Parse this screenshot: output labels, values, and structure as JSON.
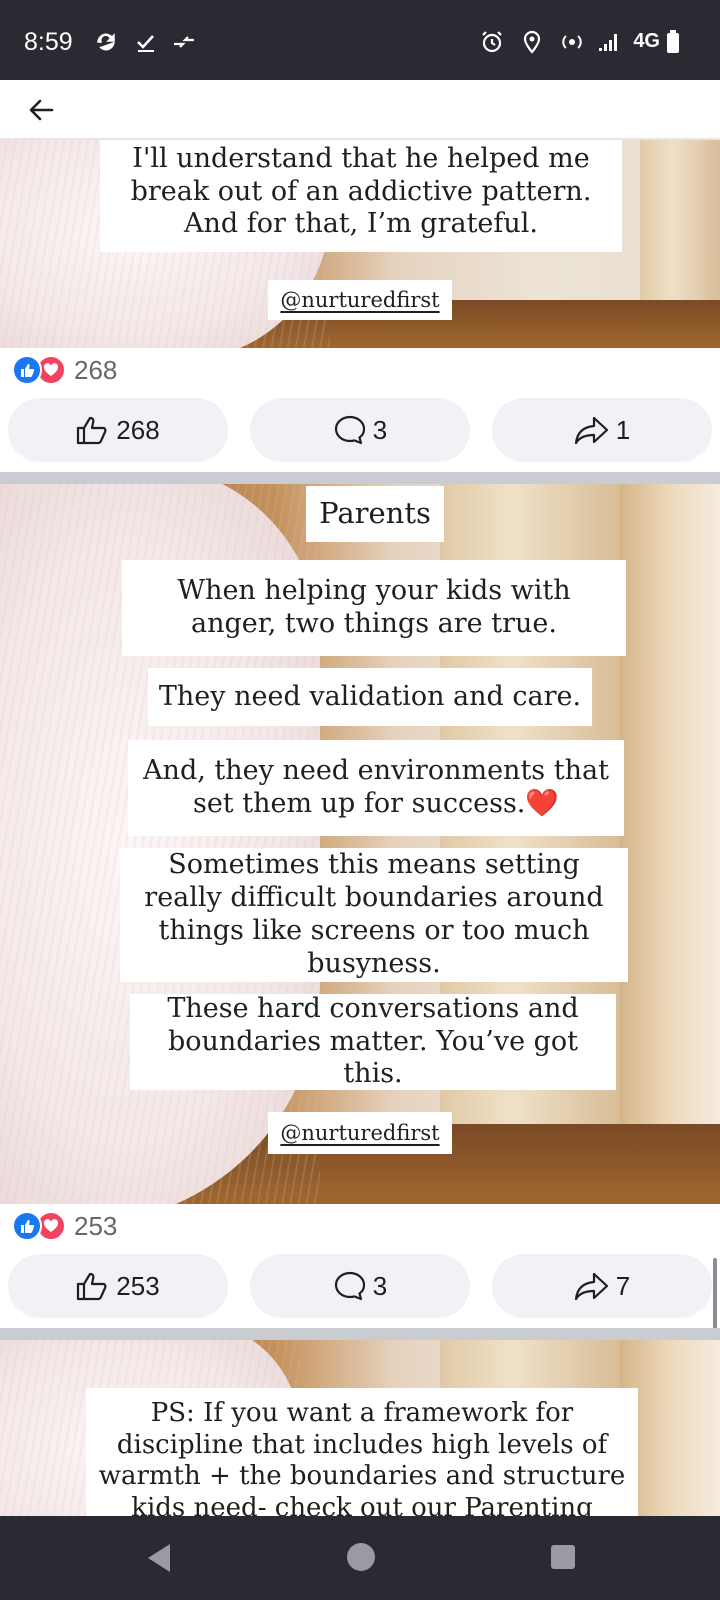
{
  "status_bar": {
    "time": "8:59",
    "network": "4G",
    "icons": [
      "sync-icon",
      "check-icon",
      "data-arrows-icon",
      "alarm-icon",
      "location-icon",
      "hotspot-icon",
      "signal-icon",
      "battery-icon"
    ]
  },
  "header": {
    "back_icon": "arrow-left-icon"
  },
  "posts": [
    {
      "caption_lines": [
        "I'll understand that he helped me",
        "break out of an addictive pattern.",
        "And for that, I’m grateful."
      ],
      "handle": "@nurturedfirst",
      "reaction_count": "268",
      "like_count": "268",
      "comment_count": "3",
      "share_count": "1"
    },
    {
      "title": "Parents",
      "blocks": [
        "When helping your kids with anger, two things are true.",
        "They need validation and care.",
        "And, they need environments that set them up for success.❤️",
        "Sometimes this means setting really difficult boundaries around things like screens or too much busyness.",
        "These hard conversations and boundaries matter. You’ve got this."
      ],
      "handle": "@nurturedfirst",
      "reaction_count": "253",
      "like_count": "253",
      "comment_count": "3",
      "share_count": "7"
    },
    {
      "caption": "PS: If you want a framework for discipline that includes high levels of warmth + the boundaries and structure kids need- check out our Parenting Little Kids course."
    }
  ],
  "colors": {
    "like_blue": "#1877f2",
    "love_red": "#f3425f",
    "pill_bg": "#f0f2f5",
    "bar_dark": "#2a2a33"
  }
}
